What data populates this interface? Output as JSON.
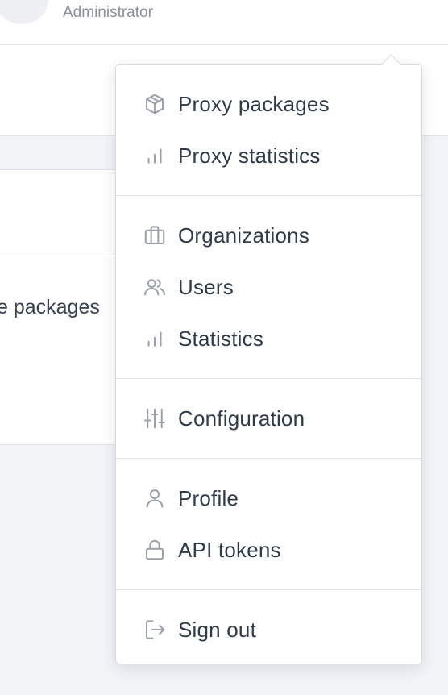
{
  "header": {
    "role": "Administrator"
  },
  "panel": {
    "text": "e packages"
  },
  "menu": {
    "groups": [
      {
        "items": [
          {
            "label": "Proxy packages",
            "icon": "package-icon"
          },
          {
            "label": "Proxy statistics",
            "icon": "bar-chart-icon"
          }
        ]
      },
      {
        "items": [
          {
            "label": "Organizations",
            "icon": "briefcase-icon"
          },
          {
            "label": "Users",
            "icon": "users-icon"
          },
          {
            "label": "Statistics",
            "icon": "bar-chart-icon"
          }
        ]
      },
      {
        "items": [
          {
            "label": "Configuration",
            "icon": "sliders-icon"
          }
        ]
      },
      {
        "items": [
          {
            "label": "Profile",
            "icon": "user-icon"
          },
          {
            "label": "API tokens",
            "icon": "lock-icon"
          }
        ]
      },
      {
        "items": [
          {
            "label": "Sign out",
            "icon": "sign-out-icon"
          }
        ]
      }
    ]
  },
  "colors": {
    "background": "#f3f4f8",
    "icon": "#9aa0ab",
    "text": "#2f3a4a"
  }
}
